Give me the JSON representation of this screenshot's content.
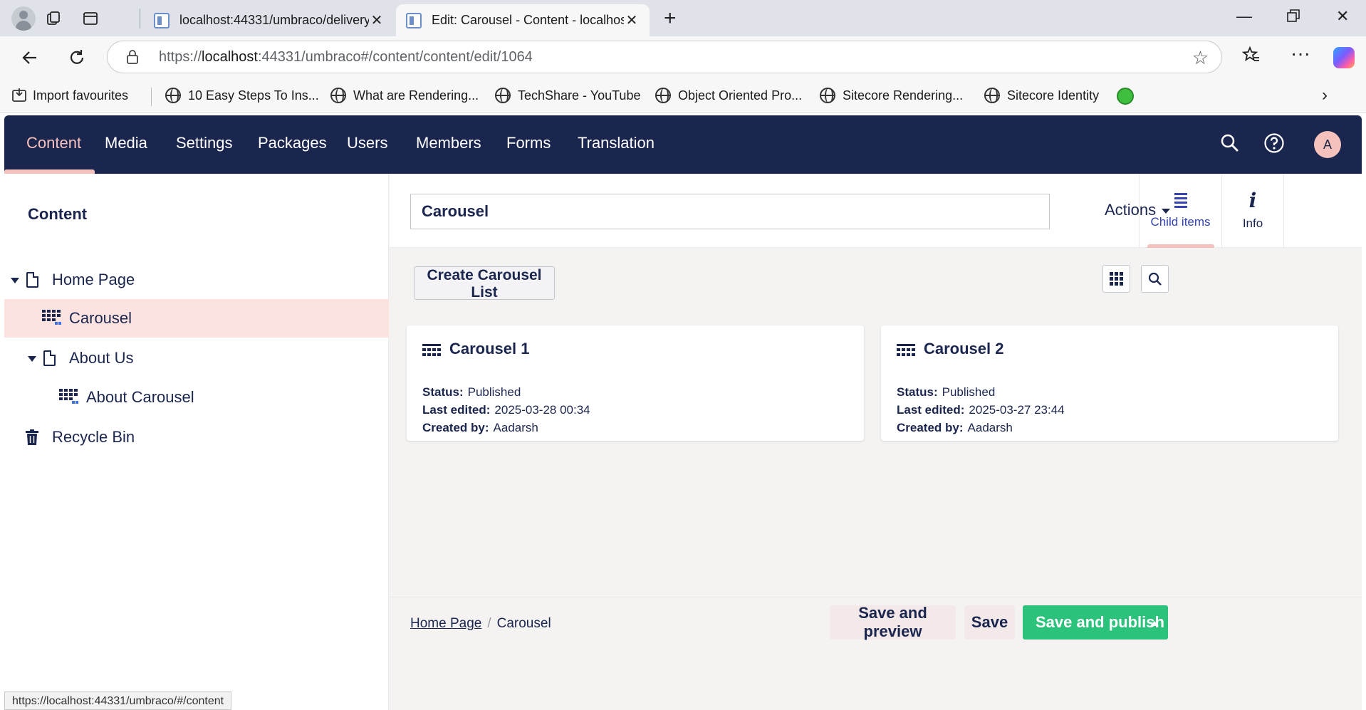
{
  "browser": {
    "tabs": [
      {
        "title": "localhost:44331/umbraco/delivery",
        "active": false
      },
      {
        "title": "Edit: Carousel - Content - localhost",
        "active": true
      }
    ],
    "url_prefix": "https://",
    "url_host": "localhost",
    "url_rest": ":44331/umbraco#/content/content/edit/1064",
    "favorites": [
      "Import favourites",
      "10 Easy Steps To Ins...",
      "What are Rendering...",
      "TechShare - YouTube",
      "Object Oriented Pro...",
      "Sitecore Rendering...",
      "Sitecore Identity"
    ],
    "status_url": "https://localhost:44331/umbraco/#/content"
  },
  "nav": {
    "sections": [
      "Content",
      "Media",
      "Settings",
      "Packages",
      "Users",
      "Members",
      "Forms",
      "Translation"
    ],
    "active_section": "Content",
    "avatar_initial": "A"
  },
  "tree": {
    "title": "Content",
    "nodes": [
      "Home Page",
      "Carousel",
      "About Us",
      "About Carousel",
      "Recycle Bin"
    ],
    "selected": "Carousel"
  },
  "editor": {
    "name_value": "Carousel",
    "app_tabs": [
      {
        "label": "Child items",
        "icon": "list-icon",
        "active": true
      },
      {
        "label": "Info",
        "icon": "info-icon",
        "active": false
      }
    ],
    "actions_label": "Actions",
    "create_button": "Create Carousel List",
    "cards": [
      {
        "title": "Carousel 1",
        "status_label": "Status:",
        "status": "Published",
        "edited_label": "Last edited:",
        "edited": "2025-03-28 00:34",
        "created_label": "Created by:",
        "created_by": "Aadarsh"
      },
      {
        "title": "Carousel 2",
        "status_label": "Status:",
        "status": "Published",
        "edited_label": "Last edited:",
        "edited": "2025-03-27 23:44",
        "created_label": "Created by:",
        "created_by": "Aadarsh"
      }
    ]
  },
  "footer": {
    "breadcrumb": [
      "Home Page",
      "Carousel"
    ],
    "breadcrumb_sep": "/",
    "save_preview": "Save and preview",
    "save": "Save",
    "save_publish": "Save and publish"
  },
  "colors": {
    "nav_bg": "#1b264f",
    "accent_pink": "#f5c1bc",
    "selected_bg": "#fde3e0",
    "publish_green": "#2bc37c",
    "active_tab_blue": "#3544b1"
  }
}
